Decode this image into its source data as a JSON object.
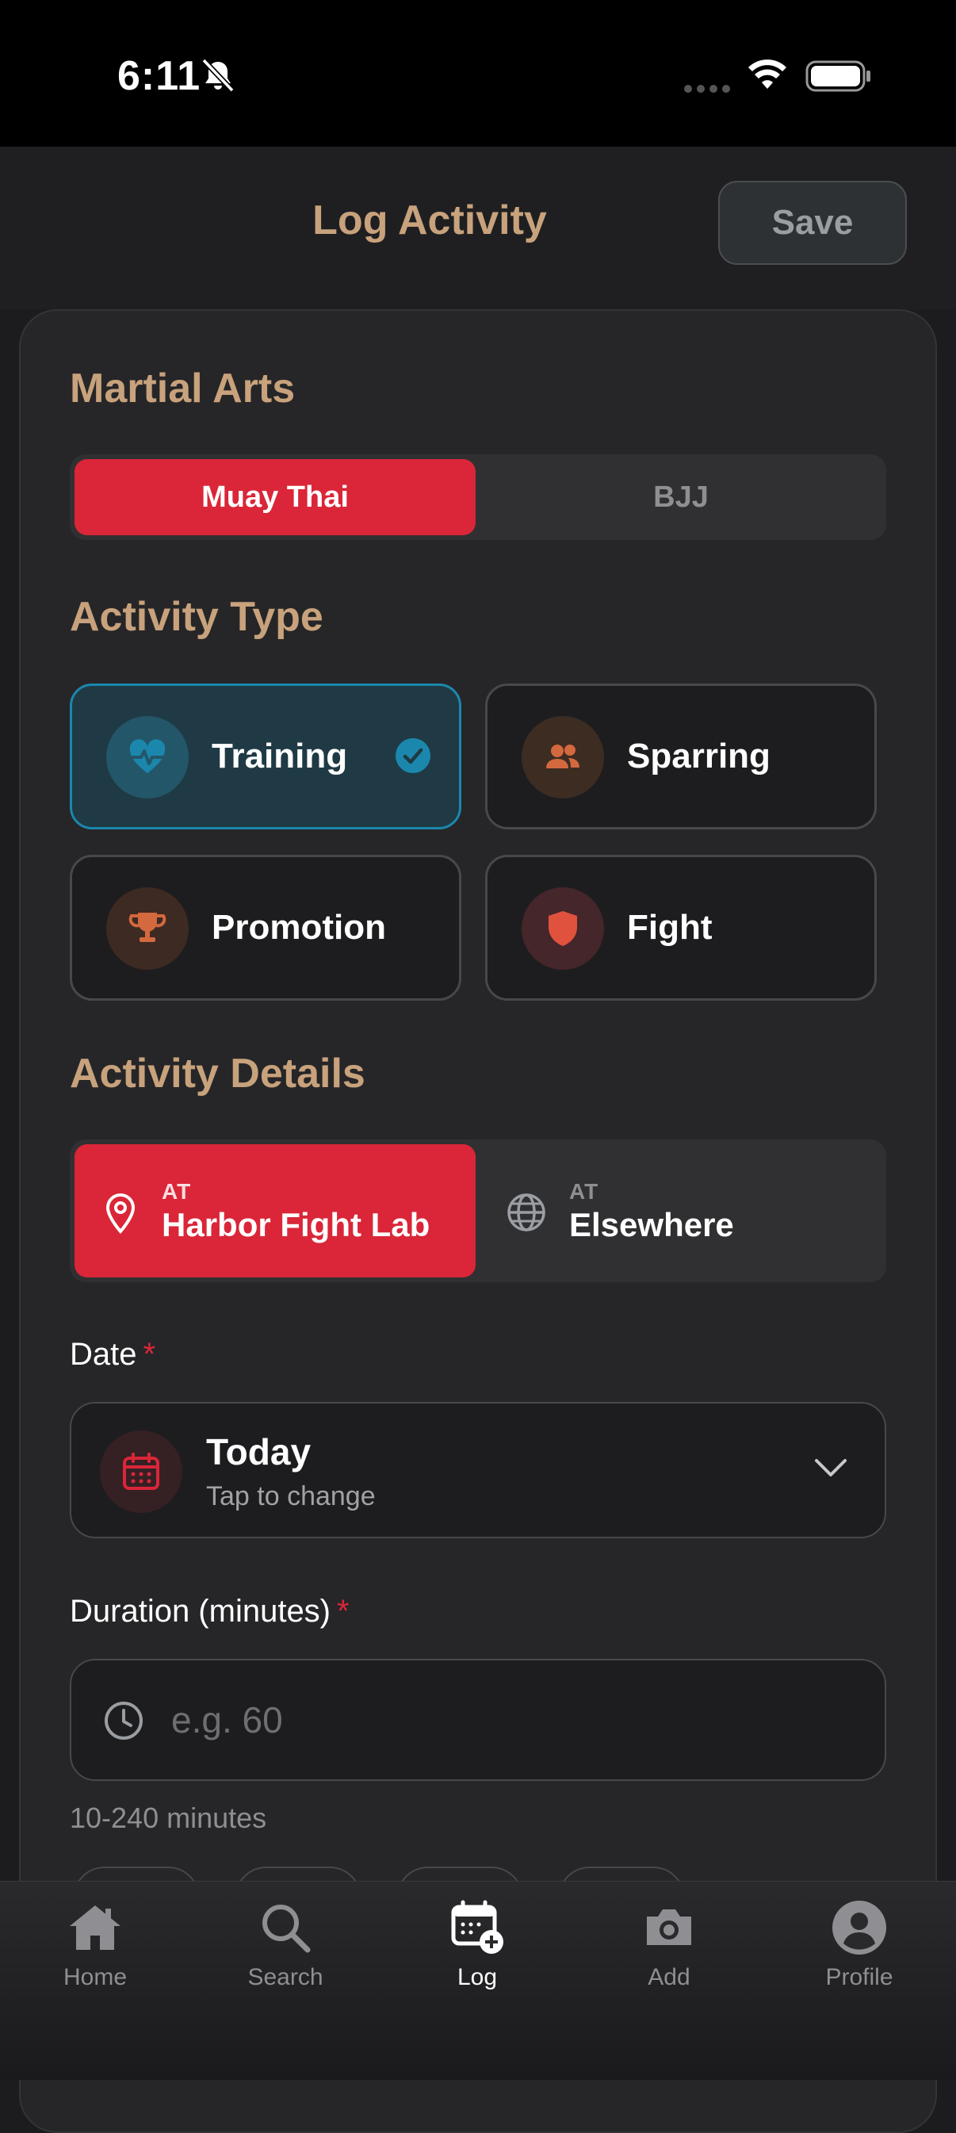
{
  "status_bar": {
    "time": "6:11"
  },
  "header": {
    "title": "Log Activity",
    "save_label": "Save"
  },
  "martial_arts": {
    "title": "Martial Arts",
    "options": [
      "Muay Thai",
      "BJJ"
    ],
    "selected": "Muay Thai"
  },
  "activity_type": {
    "title": "Activity Type",
    "options": [
      {
        "label": "Training",
        "icon": "heart-pulse-icon",
        "selected": true
      },
      {
        "label": "Sparring",
        "icon": "people-icon",
        "selected": false
      },
      {
        "label": "Promotion",
        "icon": "trophy-icon",
        "selected": false
      },
      {
        "label": "Fight",
        "icon": "shield-icon",
        "selected": false
      }
    ]
  },
  "activity_details": {
    "title": "Activity Details",
    "locations": [
      {
        "prefix": "AT",
        "name": "Harbor Fight Lab",
        "icon": "location-pin-icon",
        "selected": true
      },
      {
        "prefix": "AT",
        "name": "Elsewhere",
        "icon": "globe-icon",
        "selected": false
      }
    ]
  },
  "date": {
    "label": "Date",
    "required_mark": "*",
    "value": "Today",
    "subtext": "Tap to change"
  },
  "duration": {
    "label": "Duration (minutes)",
    "required_mark": "*",
    "placeholder": "e.g. 60",
    "hint": "10-240 minutes"
  },
  "tabbar": {
    "items": [
      {
        "label": "Home",
        "icon": "home-icon"
      },
      {
        "label": "Search",
        "icon": "search-icon"
      },
      {
        "label": "Log",
        "icon": "calendar-add-icon",
        "active": true
      },
      {
        "label": "Add",
        "icon": "camera-icon"
      },
      {
        "label": "Profile",
        "icon": "profile-icon"
      }
    ]
  },
  "colors": {
    "accent_red": "#da2638",
    "section_gold": "#c8a27c",
    "selected_teal": "#1b87ad",
    "background": "#1c1c1e"
  }
}
